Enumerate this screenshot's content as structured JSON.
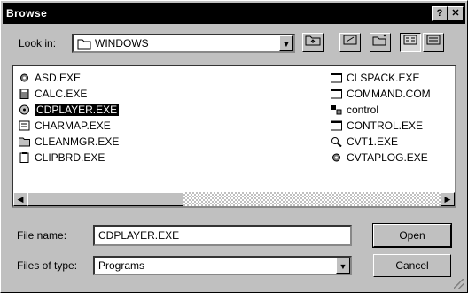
{
  "window": {
    "title": "Browse",
    "help_label": "?",
    "close_label": "✕"
  },
  "lookin": {
    "label": "Look in:",
    "value": "WINDOWS"
  },
  "files": {
    "left": [
      {
        "name": "ASD.EXE",
        "icon": "gear-icon"
      },
      {
        "name": "CALC.EXE",
        "icon": "calculator-icon"
      },
      {
        "name": "CDPLAYER.EXE",
        "icon": "cd-icon",
        "selected": true
      },
      {
        "name": "CHARMAP.EXE",
        "icon": "charmap-icon"
      },
      {
        "name": "CLEANMGR.EXE",
        "icon": "folder-icon"
      },
      {
        "name": "CLIPBRD.EXE",
        "icon": "clipboard-icon"
      }
    ],
    "right": [
      {
        "name": "CLSPACK.EXE",
        "icon": "window-icon"
      },
      {
        "name": "COMMAND.COM",
        "icon": "window-icon"
      },
      {
        "name": "control",
        "icon": "control-icon"
      },
      {
        "name": "CONTROL.EXE",
        "icon": "window-icon"
      },
      {
        "name": "CVT1.EXE",
        "icon": "search-icon"
      },
      {
        "name": "CVTAPLOG.EXE",
        "icon": "gear-icon"
      }
    ]
  },
  "filename": {
    "label": "File name:",
    "value": "CDPLAYER.EXE"
  },
  "filetype": {
    "label": "Files of type:",
    "value": "Programs"
  },
  "buttons": {
    "open": "Open",
    "cancel": "Cancel"
  }
}
